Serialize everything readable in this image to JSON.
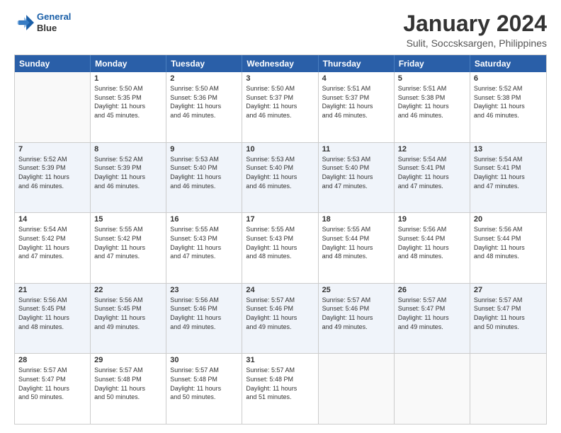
{
  "logo": {
    "line1": "General",
    "line2": "Blue"
  },
  "title": "January 2024",
  "subtitle": "Sulit, Soccsksargen, Philippines",
  "days": [
    "Sunday",
    "Monday",
    "Tuesday",
    "Wednesday",
    "Thursday",
    "Friday",
    "Saturday"
  ],
  "weeks": [
    [
      {
        "day": "",
        "info": ""
      },
      {
        "day": "1",
        "info": "Sunrise: 5:50 AM\nSunset: 5:35 PM\nDaylight: 11 hours\nand 45 minutes."
      },
      {
        "day": "2",
        "info": "Sunrise: 5:50 AM\nSunset: 5:36 PM\nDaylight: 11 hours\nand 46 minutes."
      },
      {
        "day": "3",
        "info": "Sunrise: 5:50 AM\nSunset: 5:37 PM\nDaylight: 11 hours\nand 46 minutes."
      },
      {
        "day": "4",
        "info": "Sunrise: 5:51 AM\nSunset: 5:37 PM\nDaylight: 11 hours\nand 46 minutes."
      },
      {
        "day": "5",
        "info": "Sunrise: 5:51 AM\nSunset: 5:38 PM\nDaylight: 11 hours\nand 46 minutes."
      },
      {
        "day": "6",
        "info": "Sunrise: 5:52 AM\nSunset: 5:38 PM\nDaylight: 11 hours\nand 46 minutes."
      }
    ],
    [
      {
        "day": "7",
        "info": "Sunrise: 5:52 AM\nSunset: 5:39 PM\nDaylight: 11 hours\nand 46 minutes."
      },
      {
        "day": "8",
        "info": "Sunrise: 5:52 AM\nSunset: 5:39 PM\nDaylight: 11 hours\nand 46 minutes."
      },
      {
        "day": "9",
        "info": "Sunrise: 5:53 AM\nSunset: 5:40 PM\nDaylight: 11 hours\nand 46 minutes."
      },
      {
        "day": "10",
        "info": "Sunrise: 5:53 AM\nSunset: 5:40 PM\nDaylight: 11 hours\nand 46 minutes."
      },
      {
        "day": "11",
        "info": "Sunrise: 5:53 AM\nSunset: 5:40 PM\nDaylight: 11 hours\nand 47 minutes."
      },
      {
        "day": "12",
        "info": "Sunrise: 5:54 AM\nSunset: 5:41 PM\nDaylight: 11 hours\nand 47 minutes."
      },
      {
        "day": "13",
        "info": "Sunrise: 5:54 AM\nSunset: 5:41 PM\nDaylight: 11 hours\nand 47 minutes."
      }
    ],
    [
      {
        "day": "14",
        "info": "Sunrise: 5:54 AM\nSunset: 5:42 PM\nDaylight: 11 hours\nand 47 minutes."
      },
      {
        "day": "15",
        "info": "Sunrise: 5:55 AM\nSunset: 5:42 PM\nDaylight: 11 hours\nand 47 minutes."
      },
      {
        "day": "16",
        "info": "Sunrise: 5:55 AM\nSunset: 5:43 PM\nDaylight: 11 hours\nand 47 minutes."
      },
      {
        "day": "17",
        "info": "Sunrise: 5:55 AM\nSunset: 5:43 PM\nDaylight: 11 hours\nand 48 minutes."
      },
      {
        "day": "18",
        "info": "Sunrise: 5:55 AM\nSunset: 5:44 PM\nDaylight: 11 hours\nand 48 minutes."
      },
      {
        "day": "19",
        "info": "Sunrise: 5:56 AM\nSunset: 5:44 PM\nDaylight: 11 hours\nand 48 minutes."
      },
      {
        "day": "20",
        "info": "Sunrise: 5:56 AM\nSunset: 5:44 PM\nDaylight: 11 hours\nand 48 minutes."
      }
    ],
    [
      {
        "day": "21",
        "info": "Sunrise: 5:56 AM\nSunset: 5:45 PM\nDaylight: 11 hours\nand 48 minutes."
      },
      {
        "day": "22",
        "info": "Sunrise: 5:56 AM\nSunset: 5:45 PM\nDaylight: 11 hours\nand 49 minutes."
      },
      {
        "day": "23",
        "info": "Sunrise: 5:56 AM\nSunset: 5:46 PM\nDaylight: 11 hours\nand 49 minutes."
      },
      {
        "day": "24",
        "info": "Sunrise: 5:57 AM\nSunset: 5:46 PM\nDaylight: 11 hours\nand 49 minutes."
      },
      {
        "day": "25",
        "info": "Sunrise: 5:57 AM\nSunset: 5:46 PM\nDaylight: 11 hours\nand 49 minutes."
      },
      {
        "day": "26",
        "info": "Sunrise: 5:57 AM\nSunset: 5:47 PM\nDaylight: 11 hours\nand 49 minutes."
      },
      {
        "day": "27",
        "info": "Sunrise: 5:57 AM\nSunset: 5:47 PM\nDaylight: 11 hours\nand 50 minutes."
      }
    ],
    [
      {
        "day": "28",
        "info": "Sunrise: 5:57 AM\nSunset: 5:47 PM\nDaylight: 11 hours\nand 50 minutes."
      },
      {
        "day": "29",
        "info": "Sunrise: 5:57 AM\nSunset: 5:48 PM\nDaylight: 11 hours\nand 50 minutes."
      },
      {
        "day": "30",
        "info": "Sunrise: 5:57 AM\nSunset: 5:48 PM\nDaylight: 11 hours\nand 50 minutes."
      },
      {
        "day": "31",
        "info": "Sunrise: 5:57 AM\nSunset: 5:48 PM\nDaylight: 11 hours\nand 51 minutes."
      },
      {
        "day": "",
        "info": ""
      },
      {
        "day": "",
        "info": ""
      },
      {
        "day": "",
        "info": ""
      }
    ]
  ]
}
